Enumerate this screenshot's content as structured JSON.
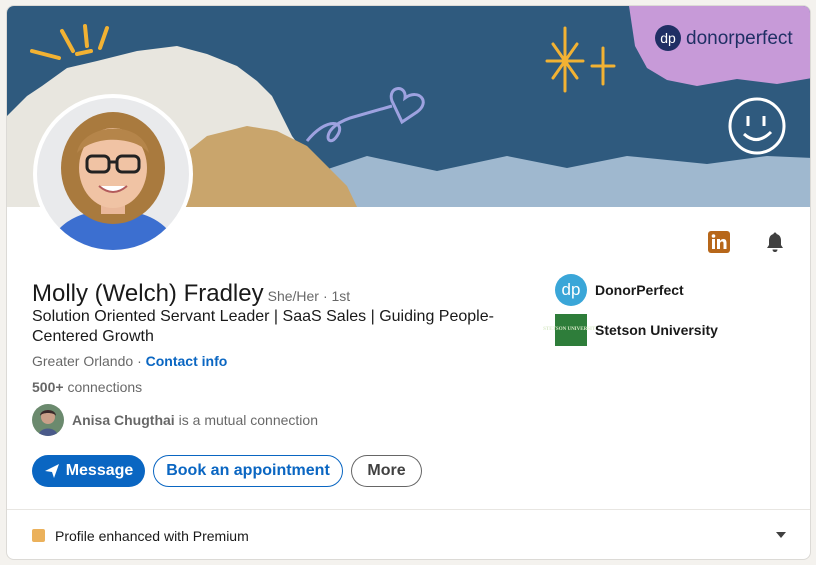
{
  "banner": {
    "brand_logo_text": "donorperfect",
    "brand_logo_mark": "dp",
    "colors": {
      "sky": "#2f5a7e",
      "sun": "#f2b233",
      "pink": "#c79ad8",
      "paper": "#e8e6df",
      "tan": "#c9a56c",
      "light_blue": "#9fb8cf"
    }
  },
  "profile": {
    "name": "Molly (Welch) Fradley",
    "pronouns": "She/Her",
    "degree": "· 1st",
    "headline": "Solution Oriented Servant Leader | SaaS Sales | Guiding People-Centered Growth",
    "location": "Greater Orlando",
    "location_separator": "·",
    "contact_link": "Contact info",
    "connections_count": "500+",
    "connections_label": "connections"
  },
  "mutual": {
    "name": "Anisa Chugthai",
    "suffix": "is a mutual connection"
  },
  "actions": {
    "message": "Message",
    "book": "Book an appointment",
    "more": "More"
  },
  "top_icons": {
    "linkedin_icon": "linkedin-icon",
    "bell_icon": "bell-icon",
    "linkedin_color": "#b7671a"
  },
  "orgs": [
    {
      "name": "DonorPerfect",
      "logo_text": "dp",
      "logo_color": "#3aa6d8"
    },
    {
      "name": "Stetson University",
      "logo_text": "STETSON UNIVERSITY",
      "logo_color": "#2e7d3a"
    }
  ],
  "premium": {
    "label": "Profile enhanced with Premium"
  }
}
